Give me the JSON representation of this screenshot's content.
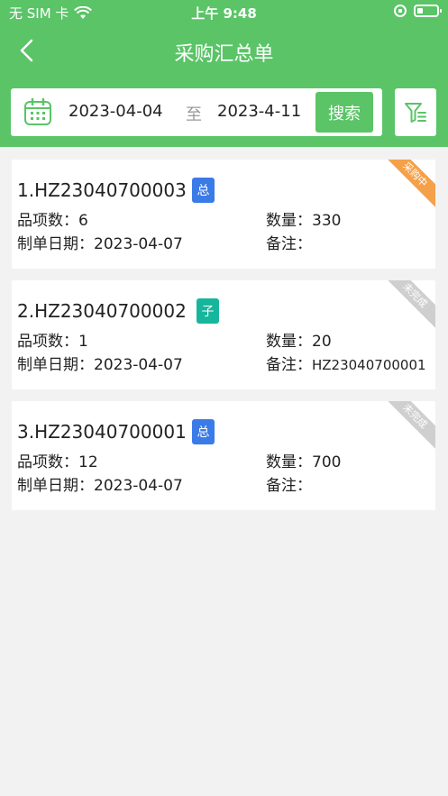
{
  "status_bar": {
    "carrier": "无 SIM 卡",
    "time": "上午 9:48"
  },
  "nav": {
    "title": "采购汇总单"
  },
  "search": {
    "start_date": "2023-04-04",
    "separator": "至",
    "end_date": "2023-4-11",
    "button_label": "搜索"
  },
  "orders": [
    {
      "code": "1.HZ23040700003",
      "badge": "总",
      "badge_color": "#3b7be8",
      "ribbon": "采购中",
      "ribbon_color": "#f5a04a",
      "items_label": "品项数：",
      "items": "6",
      "qty_label": "数量：",
      "qty": "330",
      "date_label": "制单日期：",
      "date": "2023-04-07",
      "note_label": "备注：",
      "note": ""
    },
    {
      "code": "2.HZ23040700002",
      "badge": "子",
      "badge_color": "#16b69c",
      "ribbon": "未完成",
      "ribbon_color": "#cfcfcf",
      "items_label": "品项数：",
      "items": "1",
      "qty_label": "数量：",
      "qty": "20",
      "date_label": "制单日期：",
      "date": "2023-04-07",
      "note_label": "备注：",
      "note": "HZ23040700001"
    },
    {
      "code": "3.HZ23040700001",
      "badge": "总",
      "badge_color": "#3b7be8",
      "ribbon": "未完成",
      "ribbon_color": "#cfcfcf",
      "items_label": "品项数：",
      "items": "12",
      "qty_label": "数量：",
      "qty": "700",
      "date_label": "制单日期：",
      "date": "2023-04-07",
      "note_label": "备注：",
      "note": ""
    }
  ],
  "colors": {
    "primary": "#5ac467",
    "background": "#f2f2f2"
  }
}
